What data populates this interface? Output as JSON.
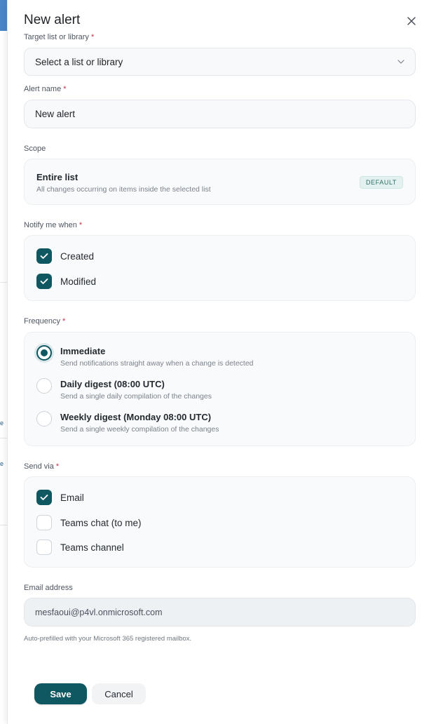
{
  "panel": {
    "title": "New alert"
  },
  "target": {
    "label": "Target list or library",
    "required_mark": "*",
    "selected_value": "Select a list or library"
  },
  "alert_name": {
    "label": "Alert name",
    "required_mark": "*",
    "value": "New alert"
  },
  "scope": {
    "label": "Scope",
    "option_title": "Entire list",
    "option_desc": "All changes occurring on items inside the selected list",
    "badge": "DEFAULT"
  },
  "notify": {
    "label": "Notify me when",
    "required_mark": "*",
    "options": [
      {
        "label": "Created",
        "checked": true
      },
      {
        "label": "Modified",
        "checked": true
      }
    ]
  },
  "frequency": {
    "label": "Frequency",
    "required_mark": "*",
    "options": [
      {
        "title": "Immediate",
        "desc": "Send notifications straight away when a change is detected",
        "selected": true
      },
      {
        "title": "Daily digest (08:00 UTC)",
        "desc": "Send a single daily compilation of the changes",
        "selected": false
      },
      {
        "title": "Weekly digest (Monday 08:00 UTC)",
        "desc": "Send a single weekly compilation of the changes",
        "selected": false
      }
    ]
  },
  "send_via": {
    "label": "Send via",
    "required_mark": "*",
    "options": [
      {
        "label": "Email",
        "checked": true
      },
      {
        "label": "Teams chat (to me)",
        "checked": false
      },
      {
        "label": "Teams channel",
        "checked": false
      }
    ]
  },
  "email": {
    "label": "Email address",
    "value": "mesfaoui@p4vl.onmicrosoft.com",
    "hint": "Auto-prefilled with your Microsoft 365 registered mailbox."
  },
  "actions": {
    "save_label": "Save",
    "cancel_label": "Cancel"
  },
  "colors": {
    "accent": "#0f5761",
    "required": "#c4314b"
  }
}
